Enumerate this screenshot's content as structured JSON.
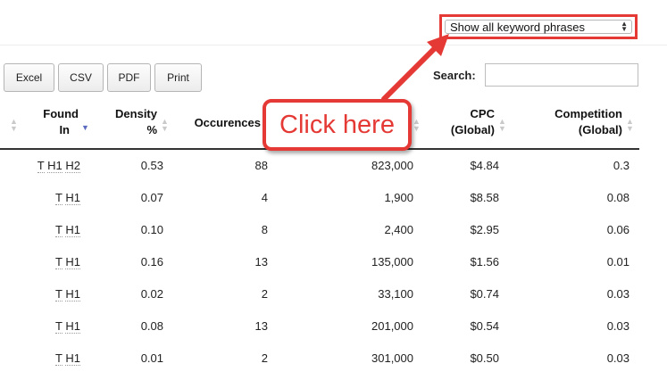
{
  "filter": {
    "selected": "Show all keyword phrases"
  },
  "export_buttons": {
    "excel": "Excel",
    "csv": "CSV",
    "pdf": "PDF",
    "print": "Print"
  },
  "search": {
    "label": "Search:",
    "value": ""
  },
  "columns": {
    "found_in_l1": "Found",
    "found_in_l2": "In",
    "density_l1": "Density",
    "density_l2": "%",
    "occurrences": "Occurences",
    "cpc_l1": "CPC",
    "cpc_l2": "(Global)",
    "competition_l1": "Competition",
    "competition_l2": "(Global)"
  },
  "annotation": {
    "text": "Click here"
  },
  "rows": [
    {
      "found_in": [
        "T",
        "H1",
        "H2"
      ],
      "density": "0.53",
      "occurrences": "88",
      "volume": "823,000",
      "cpc": "$4.84",
      "competition": "0.3"
    },
    {
      "found_in": [
        "T",
        "H1"
      ],
      "density": "0.07",
      "occurrences": "4",
      "volume": "1,900",
      "cpc": "$8.58",
      "competition": "0.08"
    },
    {
      "found_in": [
        "T",
        "H1"
      ],
      "density": "0.10",
      "occurrences": "8",
      "volume": "2,400",
      "cpc": "$2.95",
      "competition": "0.06"
    },
    {
      "found_in": [
        "T",
        "H1"
      ],
      "density": "0.16",
      "occurrences": "13",
      "volume": "135,000",
      "cpc": "$1.56",
      "competition": "0.01"
    },
    {
      "found_in": [
        "T",
        "H1"
      ],
      "density": "0.02",
      "occurrences": "2",
      "volume": "33,100",
      "cpc": "$0.74",
      "competition": "0.03"
    },
    {
      "found_in": [
        "T",
        "H1"
      ],
      "density": "0.08",
      "occurrences": "13",
      "volume": "201,000",
      "cpc": "$0.54",
      "competition": "0.03"
    },
    {
      "found_in": [
        "T",
        "H1"
      ],
      "density": "0.01",
      "occurrences": "2",
      "volume": "301,000",
      "cpc": "$0.50",
      "competition": "0.03"
    }
  ]
}
